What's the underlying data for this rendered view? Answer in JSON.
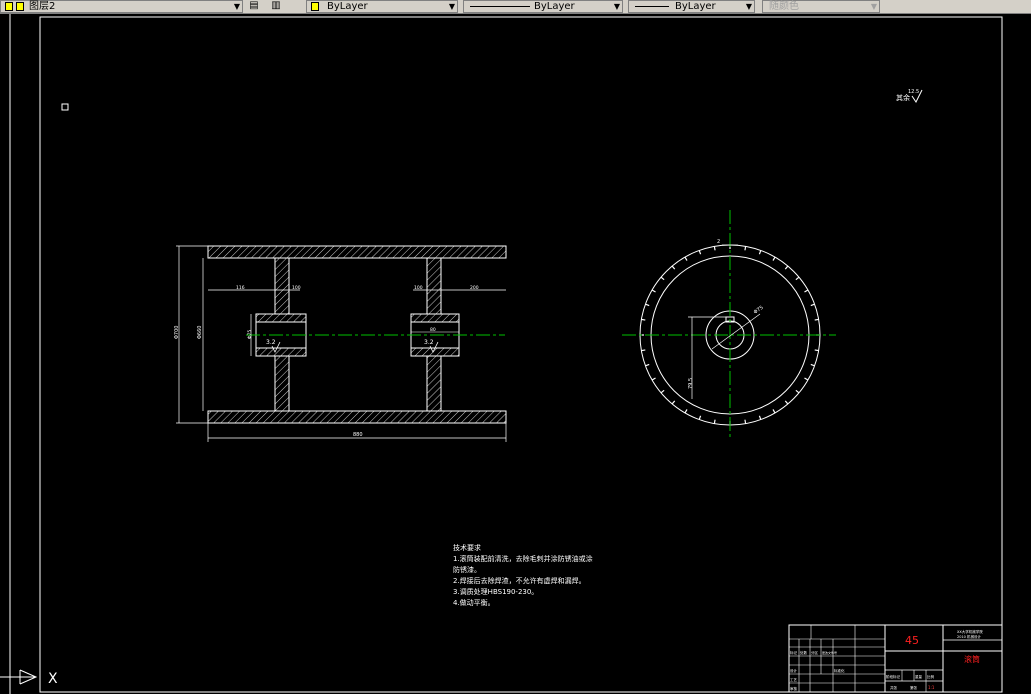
{
  "toolbar": {
    "layer_combo": "图层2",
    "color_combo": "ByLayer",
    "linetype_combo": "ByLayer",
    "lineweight_combo": "ByLayer",
    "plotstyle_combo": "随颜色"
  },
  "drawing": {
    "roughness_note": "其余",
    "roughness_value": "12.5",
    "section_roughness_left": "3.2",
    "section_roughness_right": "3.2",
    "dim_total_length": "880",
    "dim_outer_dia": "Φ700",
    "dim_inner_dia": "Φ660",
    "dim_hub_bore": "Φ75",
    "dim_left_offset": "116",
    "dim_hub_width_left": "100",
    "dim_hub_width_right": "100",
    "dim_right_offset": "200",
    "dim_hub_len": "80",
    "dim_key_width": "2",
    "dim_bore_circle": "Φ75",
    "dim_key_depth": "79.5"
  },
  "tech_notes": {
    "title": "技术要求",
    "lines": [
      "1.滚筒装配前清洗，去除毛刺并涂防锈油或涂",
      "防锈漆。",
      "2.焊接后去除焊渣，不允许有虚焊和漏焊。",
      "3.调质处理HBS190-230。",
      "4.做动平衡。"
    ]
  },
  "title_block": {
    "material": "45",
    "part_name": "滚筒",
    "school": "XX大学机械学院",
    "drawing_no": "2010 机械设计",
    "cells": [
      "标记",
      "处数",
      "分区",
      "更改文件号",
      "签名",
      "年月日",
      "设计",
      "标准化",
      "审核",
      "工艺",
      "批准",
      "阶段标记",
      "重量",
      "比例",
      "共张",
      "第张"
    ],
    "scale": "1:1"
  },
  "ucs": {
    "x_label": "X"
  }
}
